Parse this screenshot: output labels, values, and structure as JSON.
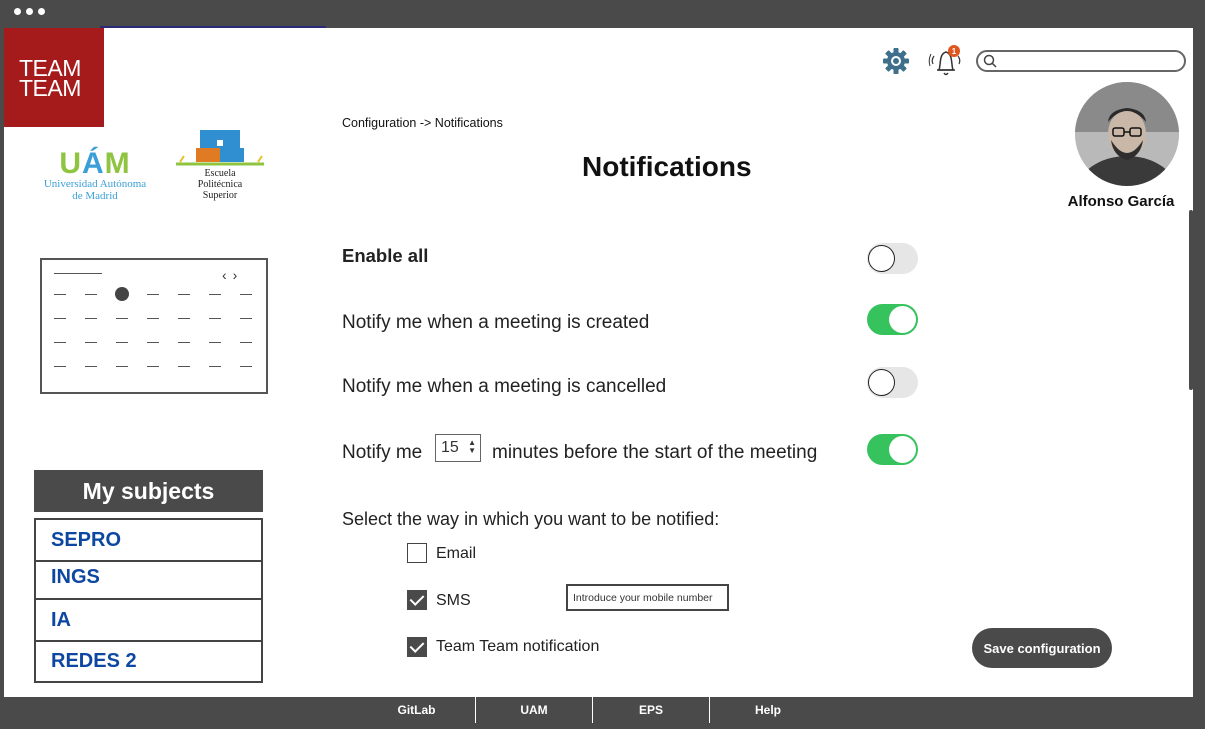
{
  "brand": {
    "logo_line1": "TEAM",
    "logo_line2": "TEAM",
    "logo_color": "#a51a1a"
  },
  "uam": {
    "mark_left": "U",
    "mark_accent": "Á",
    "mark_right": "M",
    "name_line1": "Universidad Autónoma",
    "name_line2": "de Madrid"
  },
  "eps": {
    "line1": "Escuela",
    "line2": "Politécnica",
    "line3": "Superior"
  },
  "calendar": {
    "nav_prev": "‹",
    "nav_next": "›",
    "rows": 4,
    "columns": 7,
    "selected_row": 0,
    "selected_column": 2
  },
  "subjects": {
    "heading": "My subjects",
    "items": [
      "SEPRO",
      "INGS",
      "IA",
      "REDES 2"
    ]
  },
  "header": {
    "gear_icon": "gear-icon",
    "bell_icon": "bell-icon",
    "notification_count": "1",
    "search_placeholder": ""
  },
  "user": {
    "name": "Alfonso García"
  },
  "breadcrumb": {
    "parent": "Configuration",
    "separator": "->",
    "current": "Notifications"
  },
  "page": {
    "title": "Notifications"
  },
  "settings": {
    "enable_all": {
      "label": "Enable all",
      "on": false
    },
    "meeting_created": {
      "label": "Notify me when a meeting is created",
      "on": true
    },
    "meeting_cancelled": {
      "label": "Notify me when a meeting is cancelled",
      "on": false
    },
    "before_start": {
      "prefix": "Notify me",
      "minutes": "15",
      "suffix": "minutes before the start of the meeting",
      "on": true
    }
  },
  "methods": {
    "heading": "Select the way in which you want to be notified:",
    "email": {
      "label": "Email",
      "checked": false
    },
    "sms": {
      "label": "SMS",
      "checked": true,
      "input_placeholder": "Introduce your mobile number"
    },
    "team": {
      "label": "Team Team notification",
      "checked": true
    }
  },
  "actions": {
    "save_label": "Save configuration"
  },
  "footer": {
    "links": [
      "GitLab",
      "UAM",
      "EPS",
      "Help"
    ]
  },
  "colors": {
    "toggle_on": "#36c25c",
    "frame": "#4a4a4a",
    "subject_text": "#0d47a1"
  }
}
